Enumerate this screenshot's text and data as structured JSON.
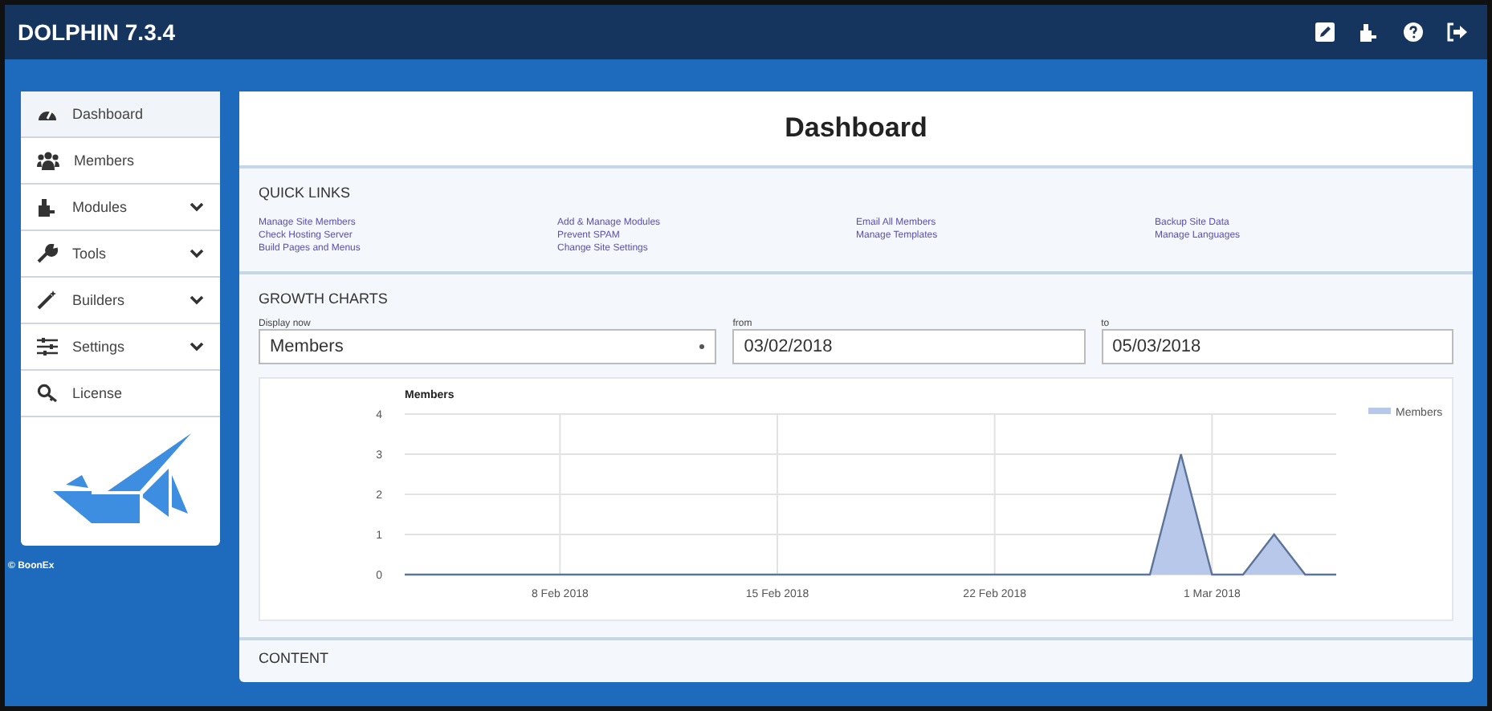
{
  "app": {
    "title": "DOLPHIN 7.3.4"
  },
  "toolbar": [
    {
      "kind": "edit"
    },
    {
      "kind": "modules"
    },
    {
      "kind": "help"
    },
    {
      "kind": "logout"
    }
  ],
  "sidebar": {
    "items": [
      {
        "label": "Dashboard",
        "kind": "dashboard",
        "expandable": false,
        "selected": true
      },
      {
        "label": "Members",
        "kind": "members",
        "expandable": false,
        "selected": false
      },
      {
        "label": "Modules",
        "kind": "modules",
        "expandable": true,
        "selected": false
      },
      {
        "label": "Tools",
        "kind": "tools",
        "expandable": true,
        "selected": false
      },
      {
        "label": "Builders",
        "kind": "builders",
        "expandable": true,
        "selected": false
      },
      {
        "label": "Settings",
        "kind": "settings",
        "expandable": true,
        "selected": false
      },
      {
        "label": "License",
        "kind": "license",
        "expandable": false,
        "selected": false
      }
    ],
    "copyright": "© BoonEx"
  },
  "page_title": "Dashboard",
  "quick_links": {
    "title": "QUICK LINKS",
    "columns": [
      [
        "Manage Site Members",
        "Check Hosting Server",
        "Build Pages and Menus"
      ],
      [
        "Add & Manage Modules",
        "Prevent SPAM",
        "Change Site Settings"
      ],
      [
        "Email All Members",
        "Manage Templates"
      ],
      [
        "Backup Site Data",
        "Manage Languages"
      ]
    ]
  },
  "growth_charts": {
    "title": "GROWTH CHARTS",
    "display_label": "Display now",
    "display_value": "Members",
    "from_label": "from",
    "from_value": "03/02/2018",
    "to_label": "to",
    "to_value": "05/03/2018",
    "chart_data": {
      "type": "area",
      "title": "Members",
      "categories": [
        null,
        null,
        null,
        null,
        null,
        "8 Feb 2018",
        null,
        null,
        null,
        null,
        null,
        null,
        "15 Feb 2018",
        null,
        null,
        null,
        null,
        null,
        null,
        "22 Feb 2018",
        null,
        null,
        null,
        null,
        null,
        null,
        "1 Mar 2018",
        null,
        null,
        null,
        null
      ],
      "grid": true,
      "series": [
        {
          "name": "Members",
          "color": "#b8c8ea",
          "values": [
            0,
            0,
            0,
            0,
            0,
            0,
            0,
            0,
            0,
            0,
            0,
            0,
            0,
            0,
            0,
            0,
            0,
            0,
            0,
            0,
            0,
            0,
            0,
            0,
            0,
            3,
            0,
            0,
            1,
            0,
            0
          ]
        }
      ],
      "ylim": [
        0,
        4
      ],
      "yticks": [
        0,
        1,
        2,
        3,
        4
      ]
    }
  },
  "content_section": {
    "title": "CONTENT"
  }
}
